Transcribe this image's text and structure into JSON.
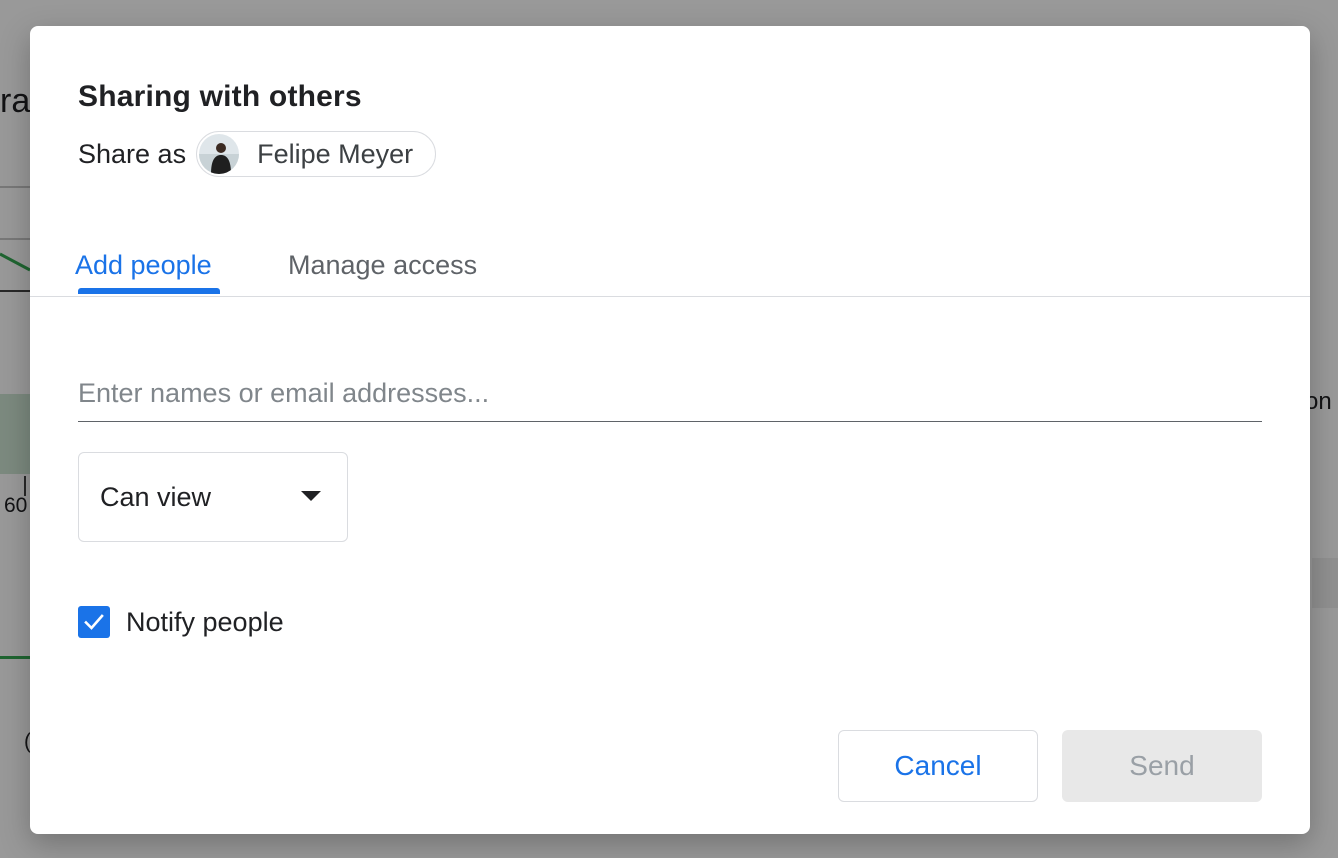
{
  "background": {
    "fragments": {
      "title": "ra",
      "tick_60": "60",
      "right_text": "on",
      "bottom_char": "("
    }
  },
  "dialog": {
    "title": "Sharing with others",
    "share_as_label": "Share as",
    "account_name": "Felipe Meyer",
    "tabs": {
      "add_people": "Add people",
      "manage_access": "Manage access",
      "active": "Add people"
    },
    "email_input": {
      "placeholder": "Enter names or email addresses...",
      "value": ""
    },
    "permission": {
      "selected": "Can view"
    },
    "notify": {
      "label": "Notify people",
      "checked": true
    },
    "buttons": {
      "cancel": "Cancel",
      "send": "Send"
    }
  },
  "colors": {
    "accent": "#1a73e8",
    "text": "#202124",
    "secondary_text": "#5f6368",
    "border": "#dadce0",
    "disabled_bg": "#e8e8e8",
    "disabled_text": "#9aa0a6"
  }
}
